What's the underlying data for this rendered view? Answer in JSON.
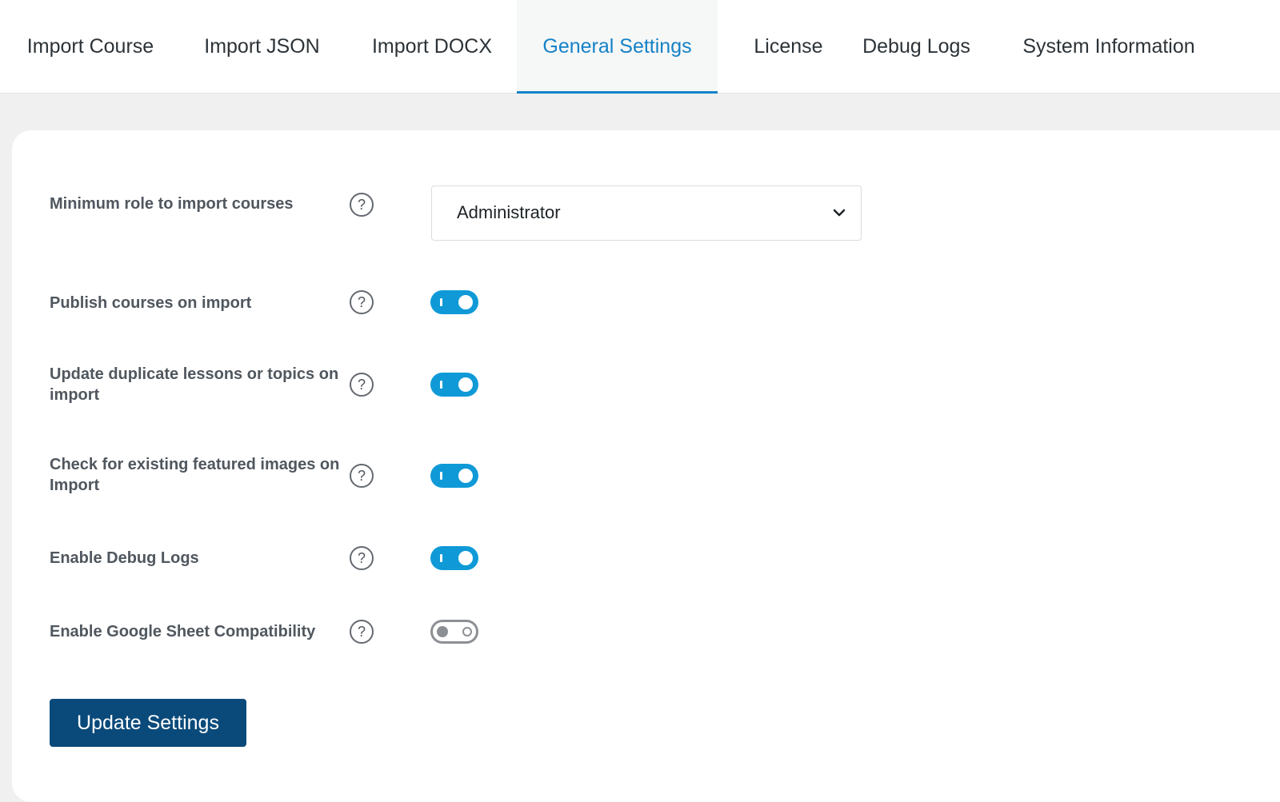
{
  "tabs": [
    {
      "label": "Import Course"
    },
    {
      "label": "Import JSON"
    },
    {
      "label": "Import DOCX"
    },
    {
      "label": "General Settings",
      "active": true
    },
    {
      "label": "License"
    },
    {
      "label": "Debug Logs"
    },
    {
      "label": "System Information"
    }
  ],
  "settings": {
    "min_role": {
      "label": "Minimum role to import courses",
      "value": "Administrator"
    },
    "publish": {
      "label": "Publish courses on import",
      "enabled": true
    },
    "update_duplicates": {
      "label": "Update duplicate lessons or topics on import",
      "enabled": true
    },
    "check_images": {
      "label": "Check for existing featured images on Import",
      "enabled": true
    },
    "debug_logs": {
      "label": "Enable Debug Logs",
      "enabled": true
    },
    "google_sheet": {
      "label": "Enable Google Sheet Compatibility",
      "enabled": false
    }
  },
  "help_glyph": "?",
  "submit_label": "Update Settings",
  "colors": {
    "accent": "#1582c7",
    "toggle_on": "#0f9ad7",
    "button": "#0a4a7a"
  },
  "icons": {
    "help": "question-circle-icon",
    "select": "chevron-down-icon"
  }
}
